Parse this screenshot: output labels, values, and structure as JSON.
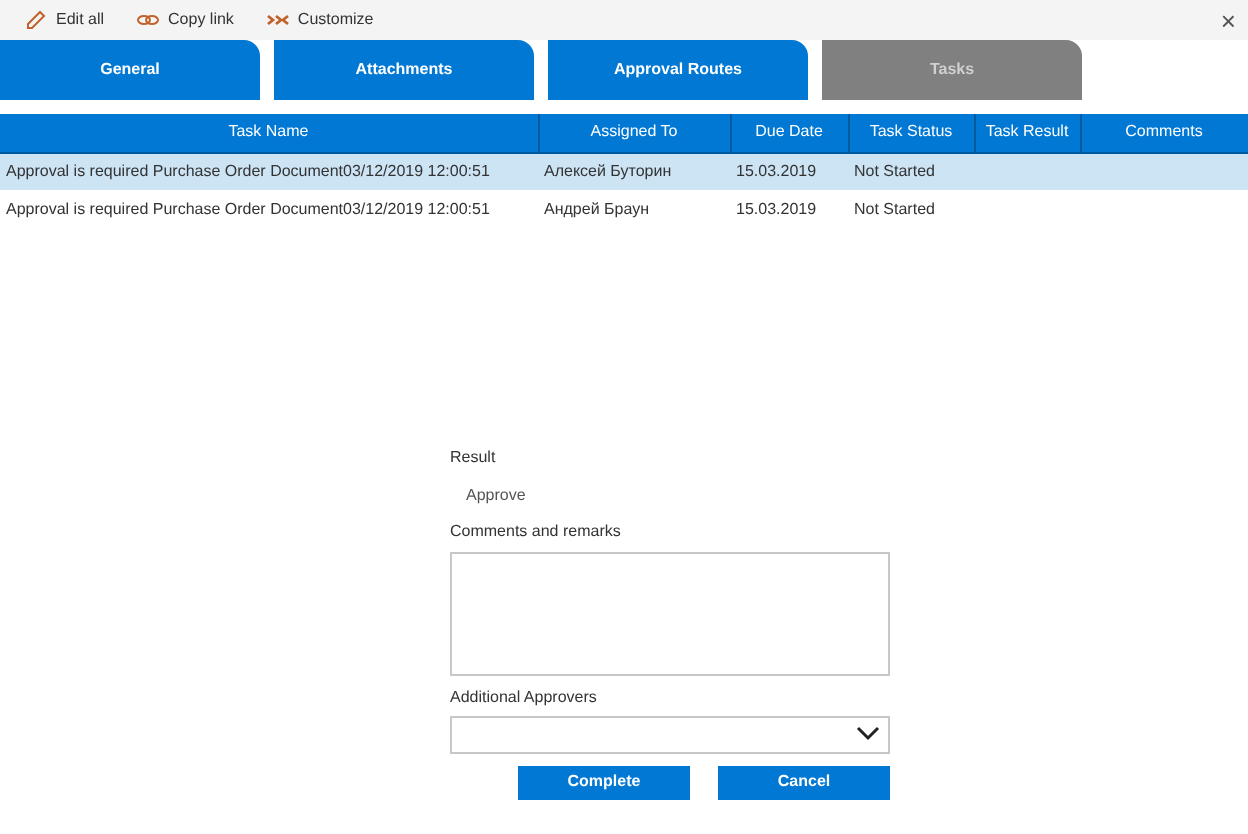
{
  "toolbar": {
    "actions": [
      {
        "label": "Edit all"
      },
      {
        "label": "Copy link"
      },
      {
        "label": "Customize"
      }
    ],
    "close": "×"
  },
  "tabs": [
    {
      "label": "General",
      "selected": false
    },
    {
      "label": "Attachments",
      "selected": false
    },
    {
      "label": "Approval Routes",
      "selected": false
    },
    {
      "label": "Tasks",
      "selected": true
    }
  ],
  "table": {
    "columns": [
      "Task Name",
      "Assigned To",
      "Due Date",
      "Task Status",
      "Task Result",
      "Comments"
    ],
    "rows": [
      {
        "selected": true,
        "cells": [
          "Approval is required Purchase Order Document03/12/2019 12:00:51",
          "Алексей Буторин",
          "15.03.2019",
          "Not Started",
          "",
          ""
        ]
      },
      {
        "selected": false,
        "cells": [
          "Approval is required Purchase Order Document03/12/2019 12:00:51",
          "Андрей Браун",
          "15.03.2019",
          "Not Started",
          "",
          ""
        ]
      }
    ]
  },
  "form": {
    "result_label": "Result",
    "result_value": "Approve",
    "comments_label": "Comments and remarks",
    "approvers_label": "Additional Approvers",
    "buttons": [
      "Complete",
      "Cancel"
    ]
  }
}
